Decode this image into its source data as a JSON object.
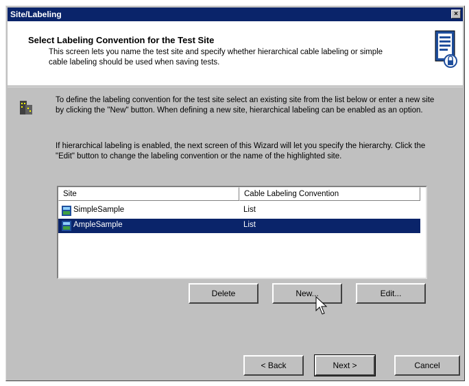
{
  "window": {
    "title": "Site/Labeling",
    "close_symbol": "×"
  },
  "header": {
    "title": "Select Labeling Convention for the Test Site",
    "description": "This screen lets you name the test site and specify whether hierarchical cable labeling or simple cable labeling should be used when saving tests."
  },
  "body": {
    "paragraph1": "To define the labeling convention for the test site select an existing site from the list below or enter a new site by clicking the \"New\" button. When defining a new site, hierarchical labeling can be enabled as an option.",
    "paragraph2": "If hierarchical labeling is enabled, the next screen of this Wizard will let you specify the hierarchy. Click the \"Edit\" button to change the labeling convention or the name of the highlighted site."
  },
  "list": {
    "columns": [
      "Site",
      "Cable Labeling Convention"
    ],
    "rows": [
      {
        "site": "SimpleSample",
        "convention": "List",
        "selected": false
      },
      {
        "site": "AmpleSample",
        "convention": "List",
        "selected": true
      }
    ]
  },
  "buttons": {
    "delete": "Delete",
    "new": "New...",
    "edit": "Edit...",
    "back": "< Back",
    "next": "Next >",
    "cancel": "Cancel"
  },
  "colors": {
    "title_bar": "#0a246a",
    "selection": "#0a246a",
    "face": "#c0c0c0"
  }
}
